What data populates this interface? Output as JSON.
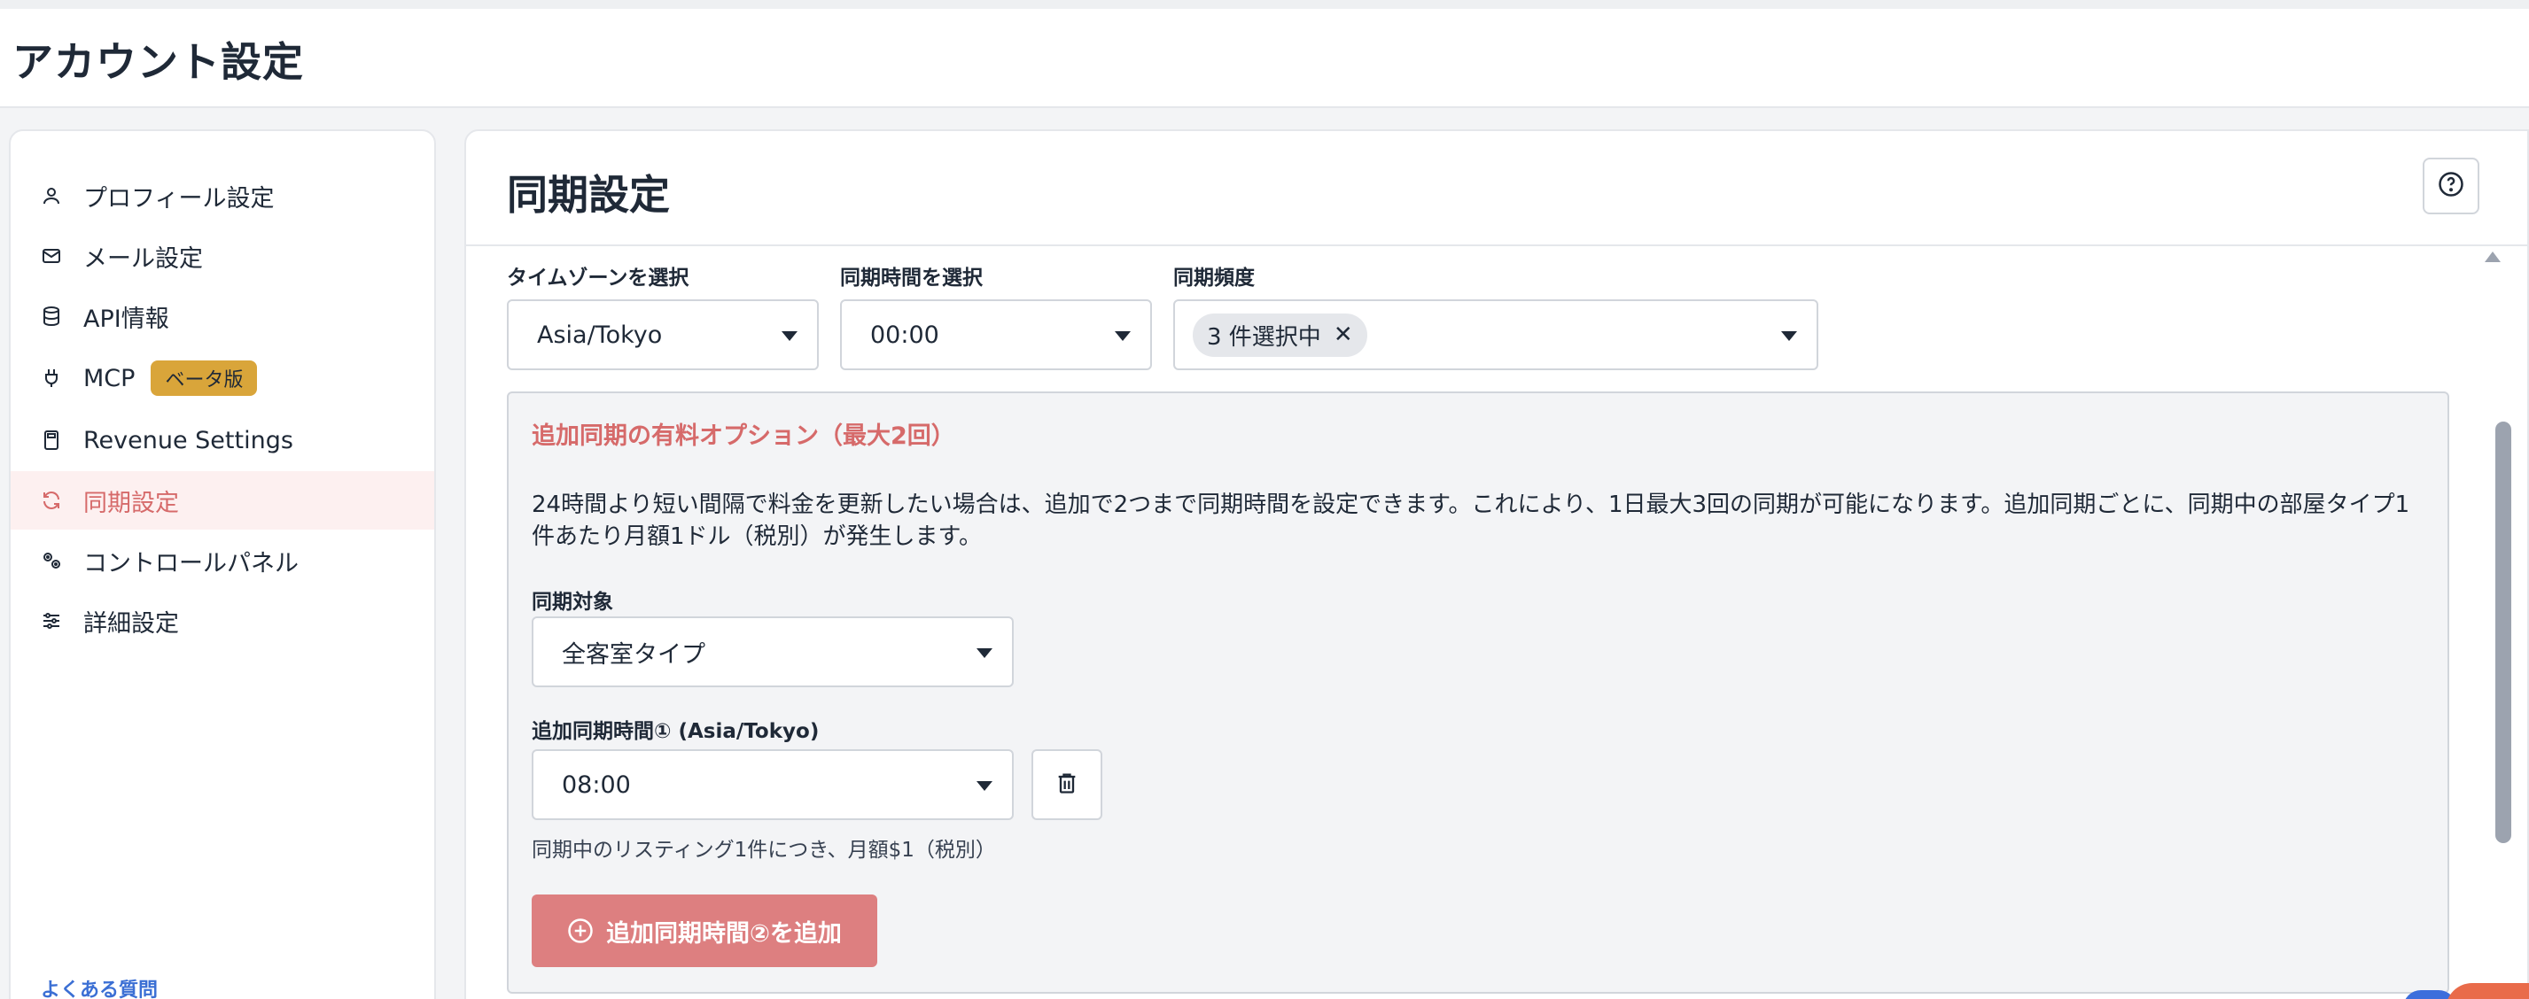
{
  "header": {
    "title": "アカウント設定"
  },
  "sidebar": {
    "items": [
      {
        "label": "プロフィール設定",
        "icon": "user-icon",
        "active": false
      },
      {
        "label": "メール設定",
        "icon": "mail-icon",
        "active": false
      },
      {
        "label": "API情報",
        "icon": "database-icon",
        "active": false
      },
      {
        "label": "MCP",
        "icon": "plug-icon",
        "active": false,
        "badge": "ベータ版"
      },
      {
        "label": "Revenue Settings",
        "icon": "calculator-icon",
        "active": false
      },
      {
        "label": "同期設定",
        "icon": "refresh-icon",
        "active": true
      },
      {
        "label": "コントロールパネル",
        "icon": "gears-icon",
        "active": false
      },
      {
        "label": "詳細設定",
        "icon": "sliders-icon",
        "active": false
      }
    ],
    "faq_label": "よくある質問"
  },
  "main": {
    "title": "同期設定",
    "help_icon": "help-circle-icon",
    "timezone": {
      "label": "タイムゾーンを選択",
      "value": "Asia/Tokyo"
    },
    "sync_time": {
      "label": "同期時間を選択",
      "value": "00:00"
    },
    "frequency": {
      "label": "同期頻度",
      "chip": "3 件選択中",
      "chip_remove": "✕"
    },
    "option": {
      "title": "追加同期の有料オプション（最大2回）",
      "description": "24時間より短い間隔で料金を更新したい場合は、追加で2つまで同期時間を設定できます。これにより、1日最大3回の同期が可能になります。追加同期ごとに、同期中の部屋タイプ1件あたり月額1ドル（税別）が発生します。",
      "target_label": "同期対象",
      "target_value": "全客室タイプ",
      "extra_time_label": "追加同期時間① (Asia/Tokyo)",
      "extra_time_value": "08:00",
      "note": "同期中のリスティング1件につき、月額$1（税別）",
      "add_button": "追加同期時間②を追加"
    }
  },
  "colors": {
    "accent": "#d66a6a",
    "active_bg": "#fdf0f0",
    "badge_bg": "#d9a53a",
    "add_button_bg": "#dd7f80",
    "link": "#3b6fd4"
  }
}
